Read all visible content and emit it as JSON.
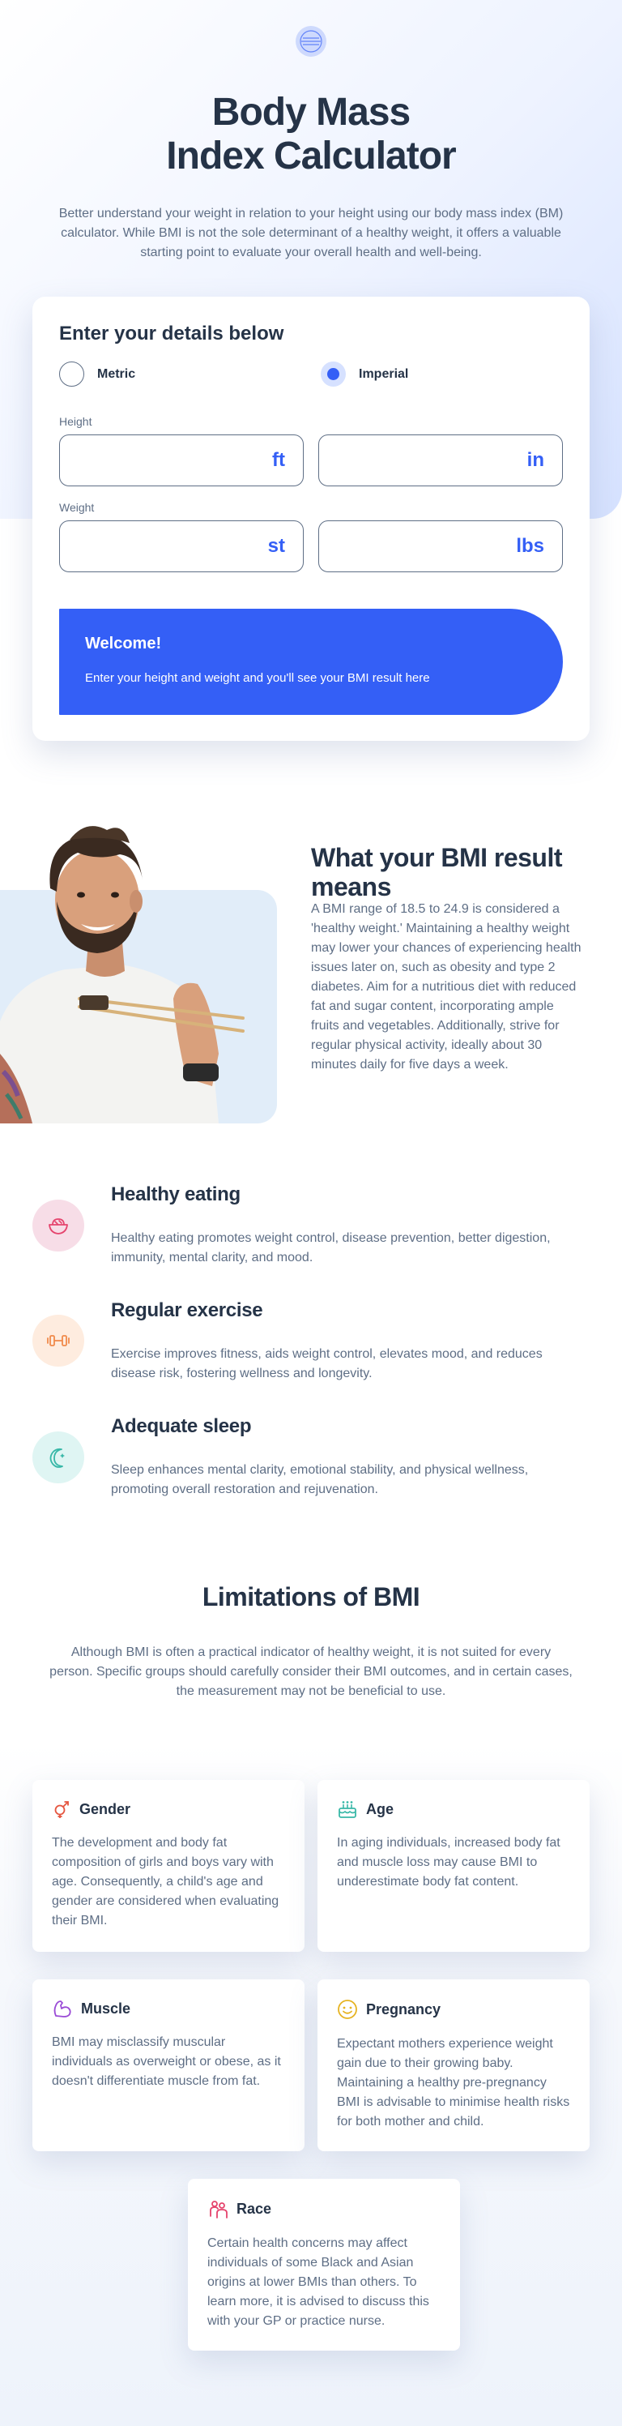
{
  "hero": {
    "title_line1": "Body Mass",
    "title_line2": "Index Calculator",
    "description": "Better understand your weight in relation to your height using our body mass index (BM) calculator. While BMI is not the sole determinant of a healthy weight, it offers a valuable starting point to evaluate your overall health and well-being."
  },
  "calculator": {
    "heading": "Enter your details below",
    "units": [
      {
        "label": "Metric",
        "selected": false
      },
      {
        "label": "Imperial",
        "selected": true
      }
    ],
    "height_label": "Height",
    "weight_label": "Weight",
    "height_units": [
      "ft",
      "in"
    ],
    "weight_units": [
      "st",
      "lbs"
    ],
    "result": {
      "title": "Welcome!",
      "text": "Enter your height and weight and you'll see your BMI result here"
    }
  },
  "meaning": {
    "title": "What your BMI result means",
    "text": "A BMI range of 18.5 to 24.9 is considered a 'healthy weight.' Maintaining a healthy weight may lower your chances of experiencing health issues later on, such as obesity and type 2 diabetes. Aim for a nutritious diet with reduced fat and sugar content, incorporating ample fruits and vegetables. Additionally, strive for regular physical activity, ideally about 30 minutes daily for five days a week."
  },
  "tips": [
    {
      "title": "Healthy eating",
      "text": "Healthy eating promotes weight control, disease prevention, better digestion, immunity, mental clarity, and mood.",
      "icon": "bowl-icon",
      "color": "#f7dde7"
    },
    {
      "title": "Regular exercise",
      "text": "Exercise improves fitness, aids weight control, elevates mood, and reduces disease risk, fostering wellness and longevity.",
      "icon": "dumbbell-icon",
      "color": "#feecdf"
    },
    {
      "title": "Adequate sleep",
      "text": "Sleep enhances mental clarity, emotional stability, and physical wellness, promoting overall restoration and rejuvenation.",
      "icon": "moon-icon",
      "color": "#dff5f3"
    }
  ],
  "limitations": {
    "title": "Limitations of BMI",
    "description": "Although BMI is often a practical indicator of healthy weight, it is not suited for every person. Specific groups should carefully consider their BMI outcomes, and in certain cases, the measurement may not be beneficial to use.",
    "cards": [
      {
        "title": "Gender",
        "icon": "gender-icon",
        "text": "The development and body fat composition of girls and boys vary with age. Consequently, a child's age and gender are considered when evaluating their BMI."
      },
      {
        "title": "Age",
        "icon": "birthday-cake-icon",
        "text": "In aging individuals, increased body fat and muscle loss may cause BMI to underestimate body fat content."
      },
      {
        "title": "Muscle",
        "icon": "flexed-arm-icon",
        "text": "BMI may misclassify muscular individuals as overweight or obese, as it doesn't differentiate muscle from fat."
      },
      {
        "title": "Pregnancy",
        "icon": "pregnancy-icon",
        "text": "Expectant mothers experience weight gain due to their growing baby. Maintaining a healthy pre-pregnancy BMI is advisable to minimise health risks for both mother and child."
      },
      {
        "title": "Race",
        "icon": "race-icon",
        "text": "Certain health concerns may affect individuals of some Black and Asian origins at lower BMIs than others. To learn more, it is advised to discuss this with your GP or practice nurse."
      }
    ]
  },
  "colors": {
    "accent": "#345ff6",
    "heading": "#253347",
    "body": "#5e6e85"
  }
}
